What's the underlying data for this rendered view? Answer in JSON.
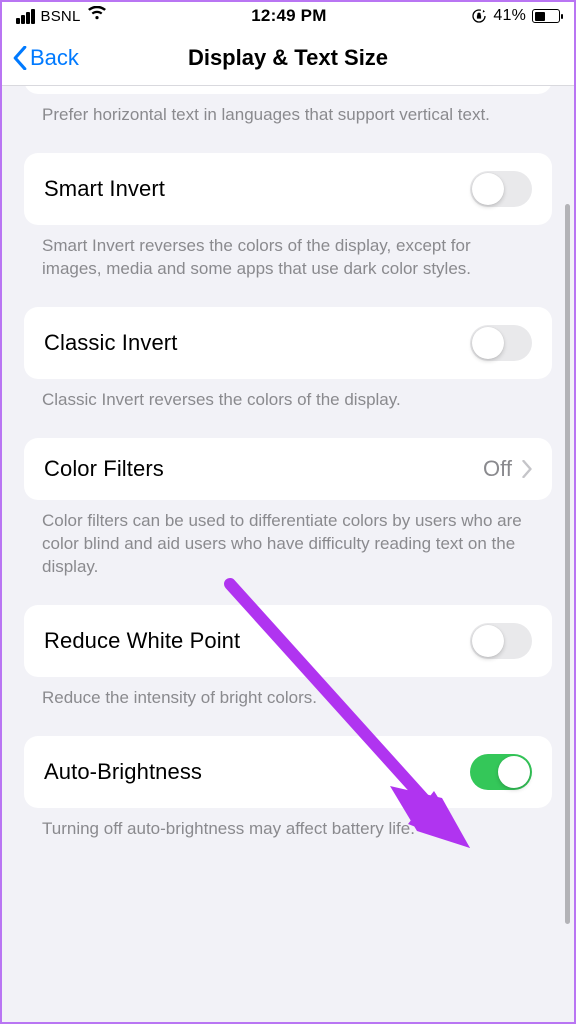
{
  "status": {
    "carrier": "BSNL",
    "time": "12:49 PM",
    "battery_pct": "41%"
  },
  "nav": {
    "back_label": "Back",
    "title": "Display & Text Size"
  },
  "sections": {
    "s0": {
      "desc": "Prefer horizontal text in languages that support vertical text."
    },
    "s1": {
      "label": "Smart Invert",
      "desc": "Smart Invert reverses the colors of the display, except for images, media and some apps that use dark color styles."
    },
    "s2": {
      "label": "Classic Invert",
      "desc": "Classic Invert reverses the colors of the display."
    },
    "s3": {
      "label": "Color Filters",
      "value": "Off",
      "desc": "Color filters can be used to differentiate colors by users who are color blind and aid users who have difficulty reading text on the display."
    },
    "s4": {
      "label": "Reduce White Point",
      "desc": "Reduce the intensity of bright colors."
    },
    "s5": {
      "label": "Auto-Brightness",
      "desc": "Turning off auto-brightness may affect battery life."
    }
  },
  "states": {
    "smart_invert": false,
    "classic_invert": false,
    "reduce_white_point": false,
    "auto_brightness": true
  }
}
